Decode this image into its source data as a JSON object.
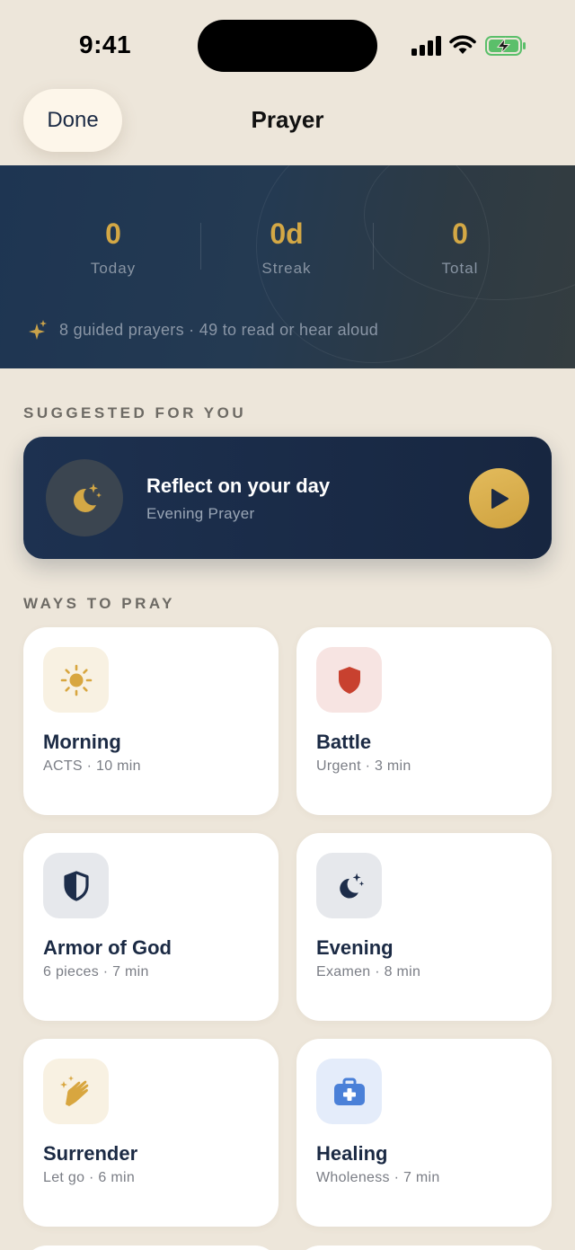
{
  "status": {
    "time": "9:41"
  },
  "nav": {
    "done_label": "Done",
    "title": "Prayer"
  },
  "stats": {
    "today": {
      "value": "0",
      "label": "Today"
    },
    "streak": {
      "value": "0d",
      "label": "Streak"
    },
    "total": {
      "value": "0",
      "label": "Total"
    },
    "note": "8 guided prayers · 49 to read or hear aloud"
  },
  "suggested": {
    "heading": "SUGGESTED FOR YOU",
    "title": "Reflect on your day",
    "subtitle": "Evening Prayer"
  },
  "ways": {
    "heading": "WAYS TO PRAY",
    "items": [
      {
        "title": "Morning",
        "subtitle": "ACTS · 10 min",
        "icon": "sun-icon"
      },
      {
        "title": "Battle",
        "subtitle": "Urgent · 3 min",
        "icon": "shield-icon"
      },
      {
        "title": "Armor of God",
        "subtitle": "6 pieces · 7 min",
        "icon": "armor-shield-icon"
      },
      {
        "title": "Evening",
        "subtitle": "Examen · 8 min",
        "icon": "moon-stars-icon"
      },
      {
        "title": "Surrender",
        "subtitle": "Let go · 6 min",
        "icon": "praying-hands-icon"
      },
      {
        "title": "Healing",
        "subtitle": "Wholeness · 7 min",
        "icon": "medical-kit-icon"
      }
    ]
  },
  "colors": {
    "background": "#ede6da",
    "accent_gold": "#d4a845",
    "navy": "#1b2a44",
    "battle_red": "#c8412f",
    "healing_blue": "#4a80d8"
  }
}
